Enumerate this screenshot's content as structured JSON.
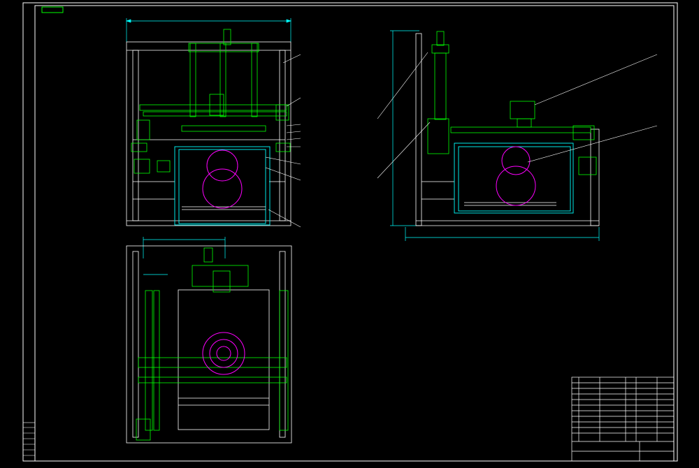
{
  "title_block": {
    "top_left_tag": "",
    "tech_title": "",
    "tech_lines": [
      "",
      "",
      "",
      "",
      "",
      ""
    ],
    "block_title": "",
    "block_label": ""
  },
  "colors": {
    "background": "#000000",
    "frame": "#ffffff",
    "part": "#00ff00",
    "dimension": "#00ffff",
    "leader": "#ffffff",
    "circle": "#ff00ff",
    "text": "#00ff00"
  }
}
